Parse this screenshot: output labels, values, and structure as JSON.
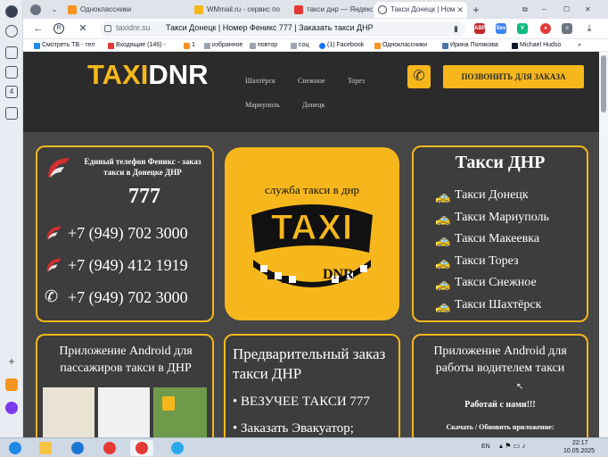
{
  "browser": {
    "tabs": [
      {
        "label": "Одноклассники",
        "favicon_color": "#f7931e"
      },
      {
        "label": "WMmail.ru - сервис по",
        "favicon_color": "#f6b71d"
      },
      {
        "label": "такси днр — Яндекс на",
        "favicon_color": "#e53935"
      },
      {
        "label": "Такси Донецк | Ном",
        "favicon_color": "#374151"
      }
    ],
    "new_tab_symbol": "+",
    "url_domain": "taxidnr.su",
    "url_title": "Такси Донецк | Номер Феникс 777 | Заказать такси ДНР",
    "bookmarks": [
      {
        "label": "Смотреть ТВ - тел",
        "color": "#1e88e5"
      },
      {
        "label": "Входящие (146) -",
        "color": "#e53935"
      },
      {
        "label": "1",
        "color": "#f7931e"
      },
      {
        "label": "избранное",
        "color": "#9ca3af"
      },
      {
        "label": "повтор",
        "color": "#9ca3af"
      },
      {
        "label": "соц",
        "color": "#9ca3af"
      },
      {
        "label": "(1) Facebook",
        "color": "#1877f2"
      },
      {
        "label": "Одноклассники",
        "color": "#f7931e"
      },
      {
        "label": "Ирина Полякова",
        "color": "#4c75a3"
      },
      {
        "label": "Michael Hudso",
        "color": "#111827"
      }
    ],
    "extensions": [
      {
        "label": "ABP",
        "color": "#c62828"
      },
      {
        "label": "Sev",
        "color": "#3b82f6"
      },
      {
        "label": "V",
        "color": "#10b981"
      },
      {
        "label": "●",
        "color": "#e53935"
      },
      {
        "label": "≡",
        "color": "#6b7280"
      }
    ]
  },
  "site": {
    "logo_part1": "TAXI",
    "logo_part2": "DNR",
    "cities": [
      "Шахтёрск",
      "Снежное",
      "Торез",
      "Мариуполь",
      "Донецк"
    ],
    "call_button": "ПОЗВОНИТЬ ДЛЯ ЗАКАЗА",
    "brand_color": "#f6b71d"
  },
  "cards": {
    "phones": {
      "heading": "Единый телефон Феникс - заказ такси в Донецке ДНР",
      "short_number": "777",
      "numbers": [
        "+7 (949) 702 3000",
        "+7 (949) 412 1919",
        "+7 (949) 702 3000"
      ]
    },
    "logo_card": {
      "caption": "служба такси в днр",
      "big_word": "TAXI",
      "sub_word": "DNR"
    },
    "cities_card": {
      "title": "Такси ДНР",
      "items": [
        "Такси Донецк",
        "Такси Мариуполь",
        "Такси Макеевка",
        "Такси Торез",
        "Такси Снежное",
        "Такси Шахтёрск"
      ]
    },
    "android_passenger": {
      "title": "Приложение Android для пассажиров такси в ДНР"
    },
    "preorder": {
      "title": "Предварительный заказ такси ДНР",
      "bullets": [
        "ВЕЗУЧЕЕ ТАКСИ 777",
        "Заказать Эвакуатор;"
      ]
    },
    "android_driver": {
      "title": "Приложение Android для работы водителем такси",
      "line1": "Работай с нами!!!",
      "line2": "Скачать / Обновить приложение:"
    }
  },
  "taskbar": {
    "lang": "EN",
    "time": "22:17",
    "date": "10.05.2025"
  }
}
